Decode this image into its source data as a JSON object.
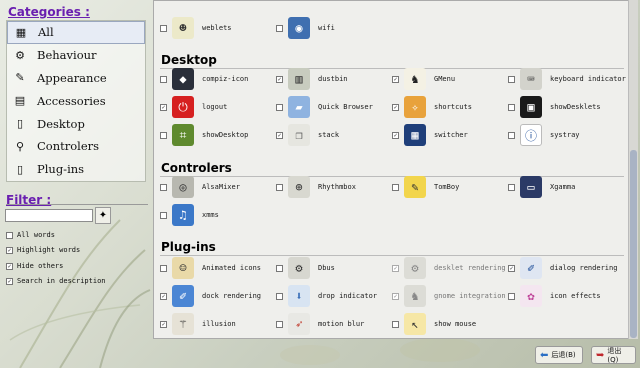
{
  "sidebar": {
    "categories_title": "Categories :",
    "categories": [
      {
        "label": "All",
        "icon": "grid-icon",
        "selected": true
      },
      {
        "label": "Behaviour",
        "icon": "gear-icon",
        "selected": false
      },
      {
        "label": "Appearance",
        "icon": "brush-icon",
        "selected": false
      },
      {
        "label": "Accessories",
        "icon": "package-icon",
        "selected": false
      },
      {
        "label": "Desktop",
        "icon": "page-icon",
        "selected": false
      },
      {
        "label": "Controlers",
        "icon": "magnifier-icon",
        "selected": false
      },
      {
        "label": "Plug-ins",
        "icon": "page-icon",
        "selected": false
      }
    ],
    "filter_title": "Filter :",
    "filter_value": "",
    "options": [
      {
        "label": "All words",
        "checked": false
      },
      {
        "label": "Highlight words",
        "checked": true
      },
      {
        "label": "Hide others",
        "checked": true
      },
      {
        "label": "Search in description",
        "checked": true
      }
    ]
  },
  "sections": [
    {
      "title": "Desktop"
    },
    {
      "title": "Controlers"
    },
    {
      "title": "Plug-ins"
    }
  ],
  "top_row": [
    {
      "label": "weblets",
      "checked": false
    },
    {
      "label": "wifi",
      "checked": false
    }
  ],
  "desktop": [
    {
      "label": "compiz-icon",
      "checked": false
    },
    {
      "label": "dustbin",
      "checked": true
    },
    {
      "label": "GMenu",
      "checked": true
    },
    {
      "label": "keyboard indicator",
      "checked": false
    },
    {
      "label": "logout",
      "checked": true
    },
    {
      "label": "Quick Browser",
      "checked": false
    },
    {
      "label": "shortcuts",
      "checked": true
    },
    {
      "label": "showDesklets",
      "checked": false
    },
    {
      "label": "showDesktop",
      "checked": false
    },
    {
      "label": "stack",
      "checked": true
    },
    {
      "label": "switcher",
      "checked": true
    },
    {
      "label": "systray",
      "checked": false
    }
  ],
  "controlers": [
    {
      "label": "AlsaMixer",
      "checked": false
    },
    {
      "label": "Rhythmbox",
      "checked": false
    },
    {
      "label": "TomBoy",
      "checked": false
    },
    {
      "label": "Xgamma",
      "checked": false
    },
    {
      "label": "xmms",
      "checked": false
    }
  ],
  "plugins": [
    {
      "label": "Animated icons",
      "checked": false
    },
    {
      "label": "Dbus",
      "checked": false
    },
    {
      "label": "desklet rendering",
      "checked": true,
      "dim": true
    },
    {
      "label": "dialog rendering",
      "checked": true
    },
    {
      "label": "dock rendering",
      "checked": true
    },
    {
      "label": "drop indicator",
      "checked": false
    },
    {
      "label": "gnome integration",
      "checked": true,
      "dim": true
    },
    {
      "label": "icon effects",
      "checked": false
    },
    {
      "label": "illusion",
      "checked": true
    },
    {
      "label": "motion blur",
      "checked": false
    },
    {
      "label": "show mouse",
      "checked": false
    }
  ],
  "buttons": {
    "back": "后退(B)",
    "quit": "退出(Q)"
  },
  "colors": {
    "accent": "#6a1fb0",
    "selection": "#e7ecf5"
  }
}
